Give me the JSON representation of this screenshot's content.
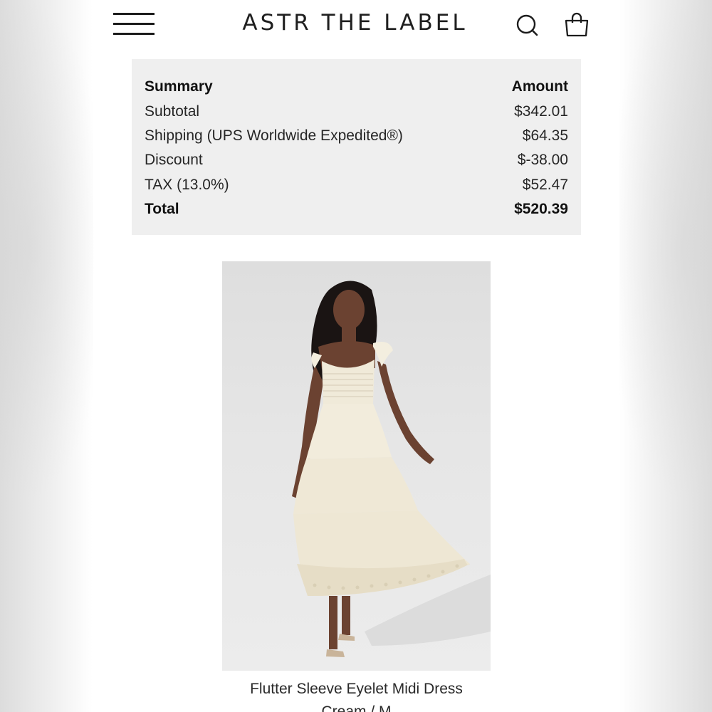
{
  "header": {
    "brand": "ASTR THE LABEL"
  },
  "summary": {
    "header_label": "Summary",
    "header_amount": "Amount",
    "rows": [
      {
        "label": "Subtotal",
        "amount": "$342.01"
      },
      {
        "label": "Shipping (UPS Worldwide Expedited®)",
        "amount": "$64.35"
      },
      {
        "label": "Discount",
        "amount": "$-38.00"
      },
      {
        "label": "TAX (13.0%)",
        "amount": "$52.47"
      }
    ],
    "total_label": "Total",
    "total_amount": "$520.39"
  },
  "product": {
    "title": "Flutter Sleeve Eyelet Midi Dress",
    "variant": "Cream / M"
  },
  "icons": {
    "menu": "hamburger-menu-icon",
    "search": "search-icon",
    "cart": "shopping-bag-icon"
  }
}
